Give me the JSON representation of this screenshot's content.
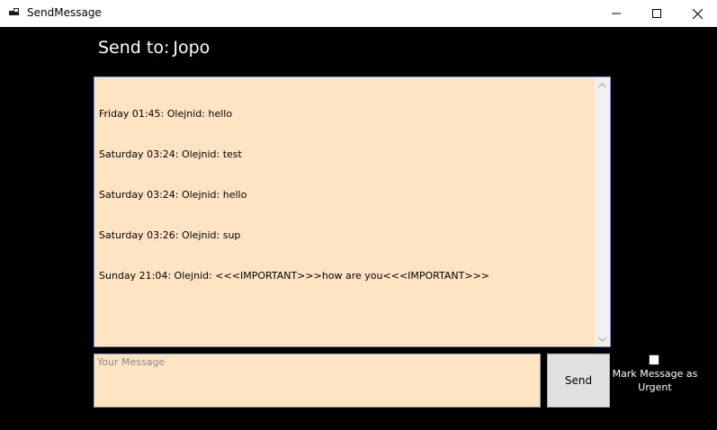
{
  "window": {
    "title": "SendMessage",
    "icons": {
      "app": "app-icon",
      "minimize": "minimize-icon",
      "maximize": "maximize-icon",
      "close": "close-icon"
    }
  },
  "header": {
    "label": "Send to:",
    "recipient": "Jopo"
  },
  "history": {
    "lines": [
      "Friday 01:45: Olejnid: hello",
      "Saturday 03:24: Olejnid: test",
      "Saturday 03:24: Olejnid: hello",
      "Saturday 03:26: Olejnid: sup",
      "Sunday 21:04: Olejnid: <<<IMPORTANT>>>how are you<<<IMPORTANT>>>"
    ]
  },
  "compose": {
    "placeholder": "Your Message",
    "value": "",
    "send_label": "Send",
    "urgent_label": "Mark Message as Urgent",
    "urgent_checked": false
  },
  "colors": {
    "background": "#000000",
    "field_background": "#ffe4c4",
    "button_background": "#e1e1e1"
  }
}
